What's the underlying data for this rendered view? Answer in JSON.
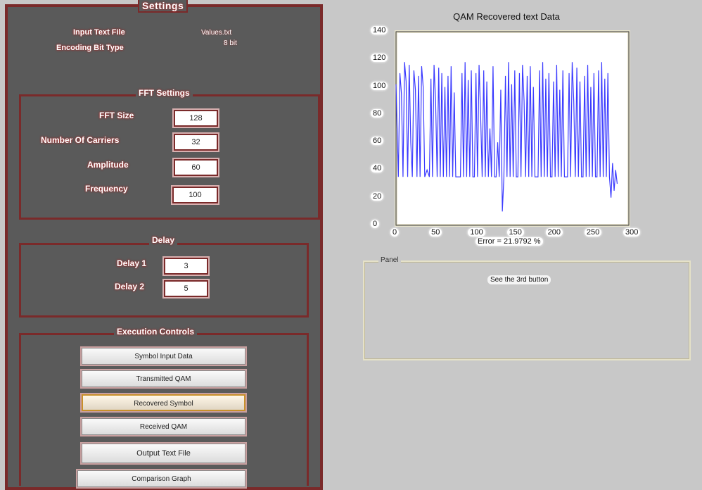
{
  "settings": {
    "title": "Settings",
    "input_text_file_label": "Input Text File",
    "input_text_file_value": "Values.txt",
    "encoding_bit_type_label": "Encoding Bit Type",
    "encoding_bit_type_value": "8 bit"
  },
  "fft": {
    "title": "FFT Settings",
    "fft_size_label": "FFT Size",
    "fft_size_value": "128",
    "carriers_label": "Number Of Carriers",
    "carriers_value": "32",
    "amplitude_label": "Amplitude",
    "amplitude_value": "60",
    "frequency_label": "Frequency",
    "frequency_value": "100"
  },
  "delay": {
    "title": "Delay",
    "delay1_label": "Delay 1",
    "delay1_value": "3",
    "delay2_label": "Delay 2",
    "delay2_value": "5"
  },
  "execution": {
    "title": "Execution Controls",
    "buttons": [
      "Symbol Input Data",
      "Transmitted QAM",
      "Recovered Symbol",
      "Received QAM",
      "Output Text File",
      "Comparison Graph"
    ]
  },
  "plot": {
    "title": "QAM Recovered text Data",
    "error_label": "Error = 21.9792 %"
  },
  "right_panel": {
    "title": "Panel",
    "message": "See the 3rd button"
  },
  "chart_data": {
    "type": "line",
    "title": "QAM Recovered text Data",
    "xlabel": "Error = 21.9792 %",
    "ylabel": "",
    "xlim": [
      0,
      300
    ],
    "ylim": [
      0,
      140
    ],
    "xticks": [
      0,
      50,
      100,
      150,
      200,
      250,
      300
    ],
    "yticks": [
      0,
      20,
      40,
      60,
      80,
      100,
      120,
      140
    ],
    "series": [
      {
        "color": "#3a3aff",
        "x": [
          0,
          3,
          5,
          7,
          9,
          11,
          13,
          15,
          17,
          19,
          21,
          23,
          25,
          27,
          29,
          31,
          33,
          35,
          37,
          40,
          43,
          45,
          47,
          49,
          51,
          53,
          55,
          57,
          59,
          61,
          63,
          65,
          67,
          69,
          71,
          73,
          75,
          77,
          80,
          83,
          85,
          87,
          89,
          91,
          93,
          95,
          97,
          99,
          101,
          103,
          105,
          107,
          109,
          111,
          113,
          115,
          117,
          119,
          121,
          123,
          125,
          127,
          129,
          131,
          133,
          135,
          137,
          139,
          141,
          143,
          145,
          147,
          149,
          151,
          153,
          155,
          157,
          159,
          161,
          163,
          165,
          167,
          169,
          171,
          173,
          175,
          177,
          179,
          181,
          183,
          185,
          187,
          189,
          191,
          193,
          195,
          197,
          199,
          201,
          203,
          205,
          207,
          209,
          211,
          213,
          215,
          217,
          219,
          221,
          223,
          225,
          227,
          229,
          231,
          233,
          235,
          237,
          239,
          241,
          243,
          245,
          247,
          249,
          251,
          253,
          255,
          257,
          259,
          261,
          263,
          265,
          267,
          269,
          271,
          273,
          275,
          277,
          279,
          281,
          283,
          285
        ],
        "y": [
          102,
          35,
          110,
          95,
          35,
          118,
          104,
          35,
          116,
          60,
          35,
          112,
          98,
          35,
          108,
          35,
          115,
          100,
          35,
          40,
          35,
          106,
          35,
          116,
          90,
          35,
          114,
          35,
          110,
          35,
          100,
          35,
          108,
          35,
          115,
          35,
          96,
          35,
          35,
          35,
          110,
          35,
          118,
          35,
          105,
          35,
          112,
          35,
          35,
          110,
          35,
          116,
          80,
          35,
          112,
          35,
          104,
          35,
          70,
          35,
          115,
          35,
          35,
          60,
          35,
          98,
          10,
          35,
          108,
          35,
          118,
          35,
          102,
          35,
          112,
          35,
          35,
          110,
          35,
          116,
          90,
          35,
          108,
          35,
          115,
          35,
          100,
          35,
          35,
          35,
          112,
          35,
          118,
          35,
          106,
          35,
          110,
          35,
          35,
          104,
          35,
          116,
          35,
          98,
          35,
          112,
          35,
          35,
          35,
          110,
          35,
          118,
          90,
          35,
          114,
          35,
          104,
          35,
          35,
          108,
          35,
          116,
          35,
          100,
          35,
          110,
          35,
          35,
          112,
          35,
          118,
          35,
          106,
          35,
          110,
          35,
          20,
          45,
          25,
          40,
          30
        ]
      }
    ]
  }
}
